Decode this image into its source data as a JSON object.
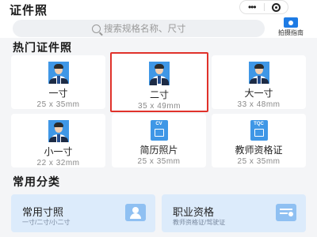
{
  "header": {
    "title": "证件照",
    "menu_icon": "more-dots-icon",
    "target_icon": "target-icon"
  },
  "search": {
    "placeholder": "搜索规格名称、尺寸"
  },
  "guide": {
    "label": "拍摄指南",
    "icon": "camera-guide-icon"
  },
  "hot": {
    "title": "热门证件照",
    "items": [
      {
        "name": "一寸",
        "size": "25 x 35mm",
        "kind": "portrait"
      },
      {
        "name": "二寸",
        "size": "35 x 49mm",
        "kind": "portrait",
        "selected": true
      },
      {
        "name": "大一寸",
        "size": "33 x 48mm",
        "kind": "portrait"
      },
      {
        "name": "小一寸",
        "size": "22 x 32mm",
        "kind": "portrait"
      },
      {
        "name": "简历照片",
        "size": "25 x 35mm",
        "kind": "doc",
        "tag": "CV"
      },
      {
        "name": "教师资格证",
        "size": "25 x 35mm",
        "kind": "doc",
        "tag": "TQC"
      }
    ]
  },
  "categories": {
    "title": "常用分类",
    "items": [
      {
        "name": "常用寸照",
        "sub": "一寸/二寸/小二寸",
        "icon": "portrait-card-icon"
      },
      {
        "name": "职业资格",
        "sub": "教师资格证/驾驶证",
        "icon": "id-card-icon"
      }
    ]
  },
  "colors": {
    "accent": "#3f97e6",
    "highlight": "#e0322b",
    "category_bg": "#dcebfb"
  }
}
